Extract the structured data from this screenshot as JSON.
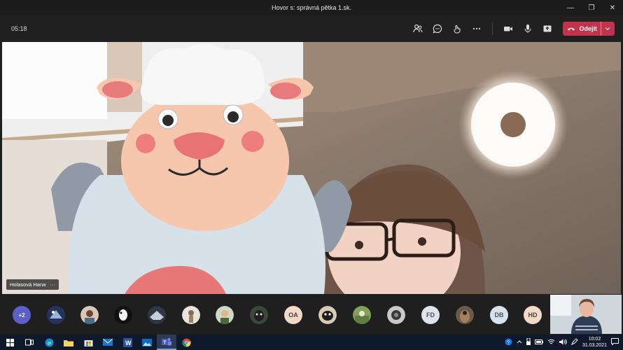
{
  "window": {
    "title": "Hovor s: správná pětka 1.sk."
  },
  "call": {
    "timer": "05:18",
    "leave_label": "Odejít",
    "accent": "#c4314b"
  },
  "video": {
    "speaker_name": "Holasová Hana",
    "more": "···"
  },
  "participants": {
    "overflow": "+2",
    "initials": [
      "OA",
      "FD",
      "DB",
      "HD"
    ]
  },
  "taskbar": {
    "time": "10:02",
    "date": "31.03.2021"
  }
}
